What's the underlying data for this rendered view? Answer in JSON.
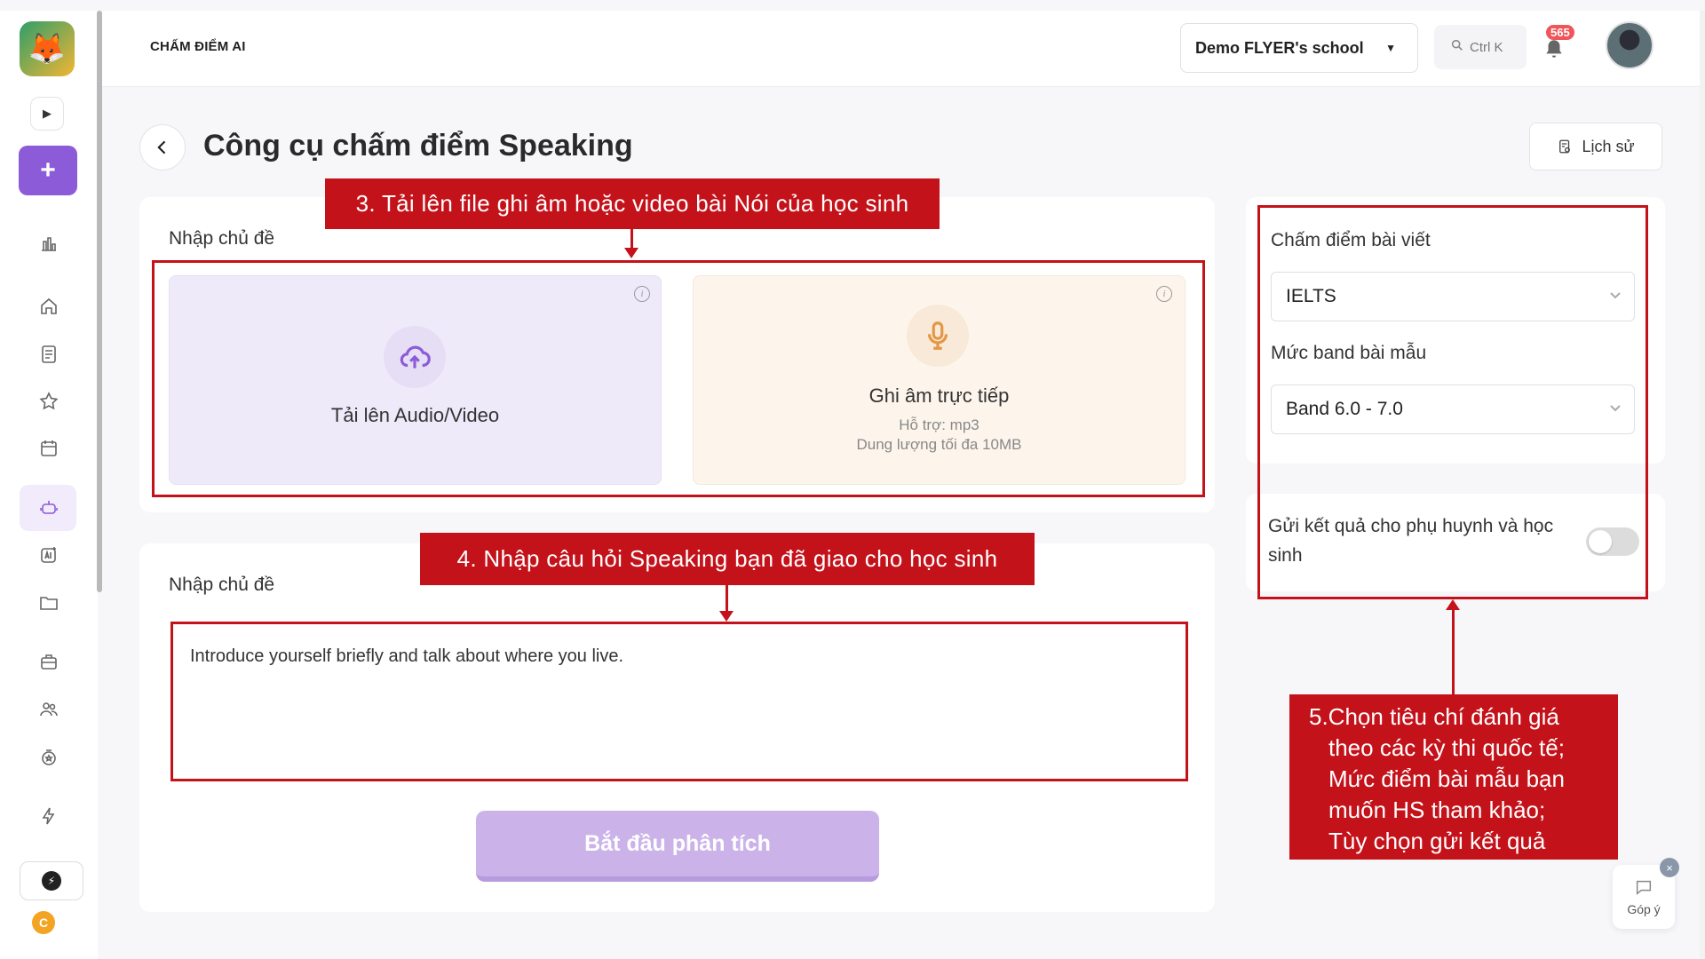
{
  "header": {
    "app_title": "CHẤM ĐIỂM AI",
    "school_select": "Demo FLYER's school",
    "search_shortcut": "Ctrl K",
    "notification_count": "565"
  },
  "page": {
    "title": "Công cụ chấm điểm Speaking",
    "history_label": "Lịch sử"
  },
  "upload": {
    "label": "Nhập chủ đề",
    "audio_tile_title": "Tải lên Audio/Video",
    "record_tile_title": "Ghi âm trực tiếp",
    "record_support": "Hỗ trợ: mp3",
    "record_limit": "Dung lượng tối đa 10MB"
  },
  "question": {
    "label": "Nhập chủ đề",
    "value": "Introduce yourself briefly and talk about where you live."
  },
  "start_button": "Bắt đầu phân tích",
  "settings": {
    "grading_label": "Chấm điểm bài viết",
    "grading_value": "IELTS",
    "band_label": "Mức band bài mẫu",
    "band_value": "Band 6.0 - 7.0",
    "toggle_label": "Gửi kết quả cho phụ huynh và học sinh",
    "toggle_on": false
  },
  "annotations": {
    "step3": "3. Tải lên file ghi âm hoặc video bài Nói của học sinh",
    "step4": "4. Nhập câu hỏi Speaking bạn đã giao cho học sinh",
    "step5_lines": [
      "5.Chọn tiêu chí đánh giá",
      "theo các kỳ thi quốc tế;",
      "Mức điểm bài mẫu bạn",
      "muốn HS tham khảo;",
      "Tùy chọn gửi kết quả"
    ]
  },
  "sidebar": {
    "coin_label": "C"
  },
  "feedback": {
    "label": "Góp ý"
  },
  "colors": {
    "accent": "#8c5bd8",
    "annotation_red": "#c4121a",
    "start_button": "#cbb3ea"
  }
}
